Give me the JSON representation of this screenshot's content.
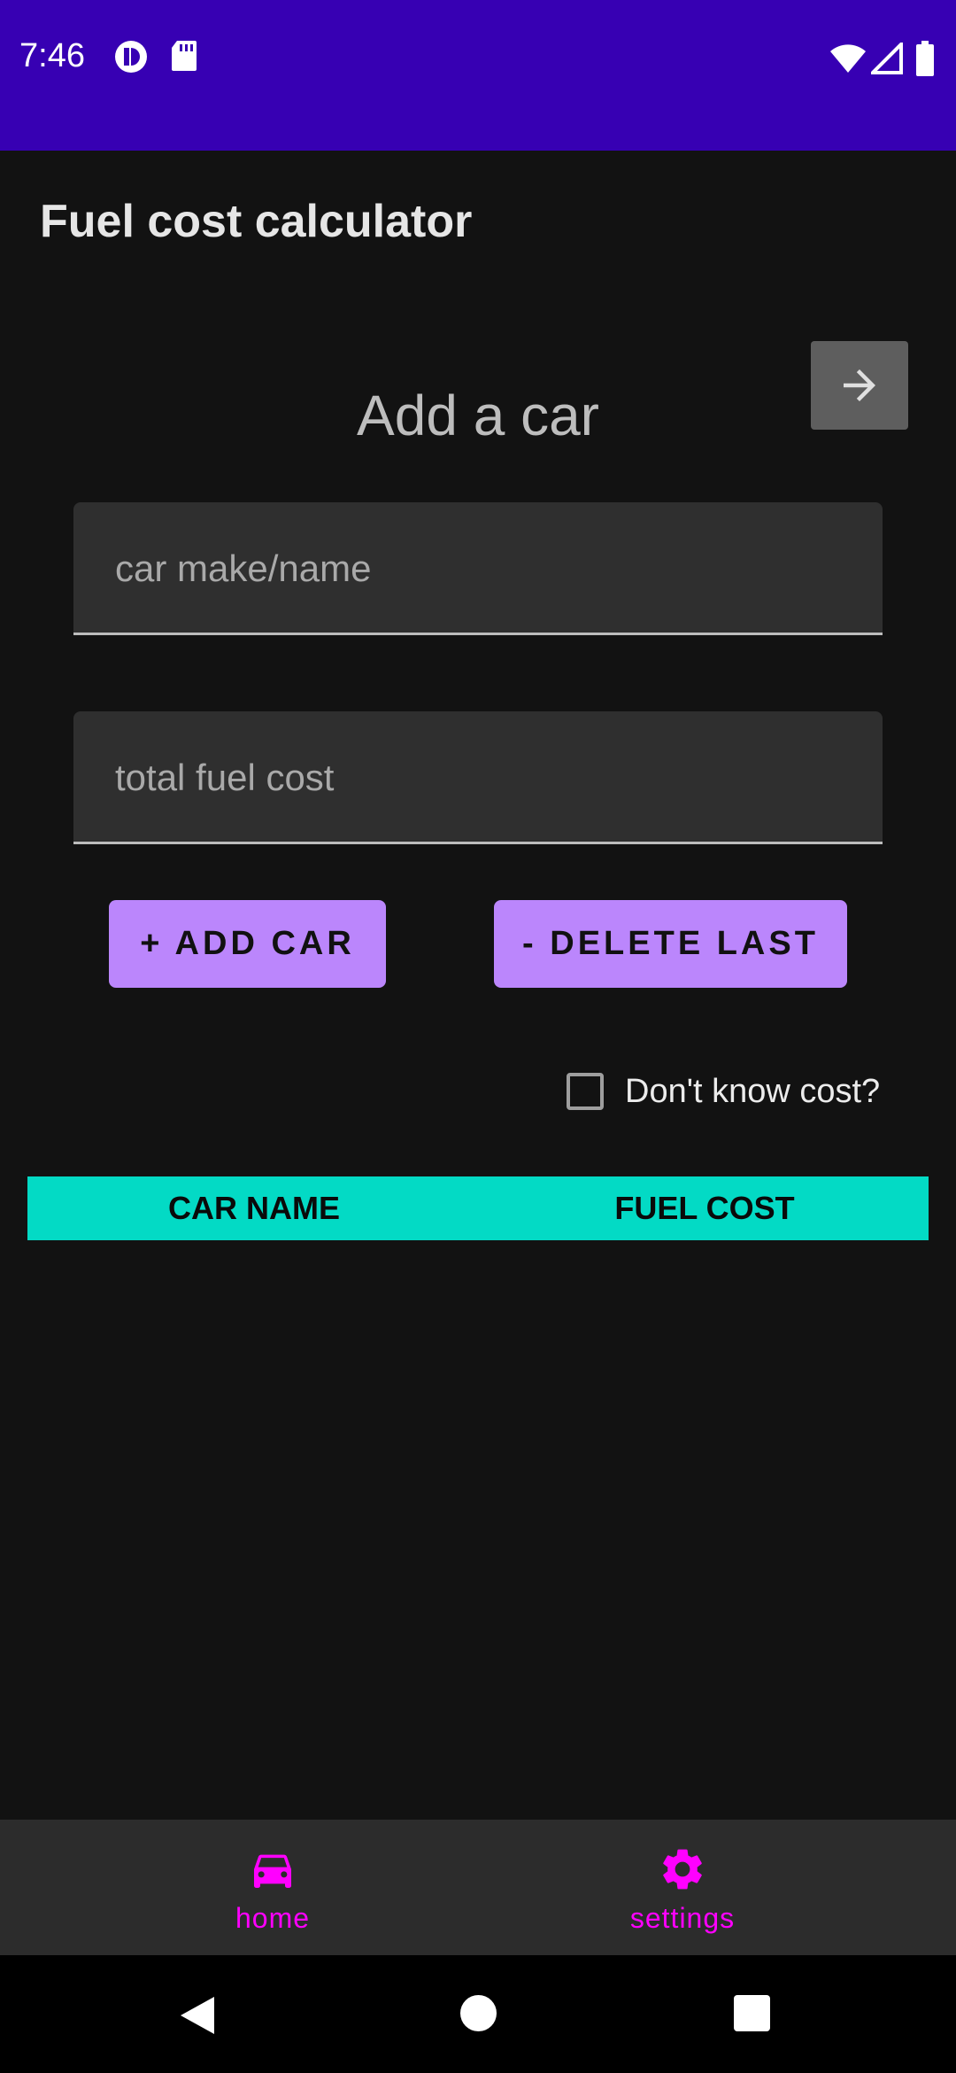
{
  "status_bar": {
    "time": "7:46",
    "left_icons": [
      "app-notification-icon",
      "sd-card-icon"
    ],
    "right_icons": [
      "wifi-icon",
      "cell-signal-icon",
      "battery-icon"
    ],
    "background": "#3700B3"
  },
  "app_bar": {
    "title": "Fuel cost calculator"
  },
  "main": {
    "section_title": "Add a car",
    "next_button_icon": "arrow-right-icon",
    "car_name_field": {
      "placeholder": "car make/name",
      "value": ""
    },
    "fuel_cost_field": {
      "placeholder": "total fuel cost",
      "value": ""
    },
    "add_car_label": "+ ADD CAR",
    "delete_last_label": "- DELETE LAST",
    "dont_know_label": "Don't know cost?",
    "dont_know_checked": false,
    "table": {
      "columns": [
        "CAR NAME",
        "FUEL COST"
      ],
      "rows": []
    }
  },
  "bottom_nav": {
    "items": [
      {
        "label": "home",
        "icon": "car-icon",
        "selected": true
      },
      {
        "label": "settings",
        "icon": "gear-icon",
        "selected": false
      }
    ]
  },
  "colors": {
    "accent": "#BB86FC",
    "table_header": "#03DAC5",
    "nav_active": "#FF00FF",
    "background": "#121212"
  }
}
